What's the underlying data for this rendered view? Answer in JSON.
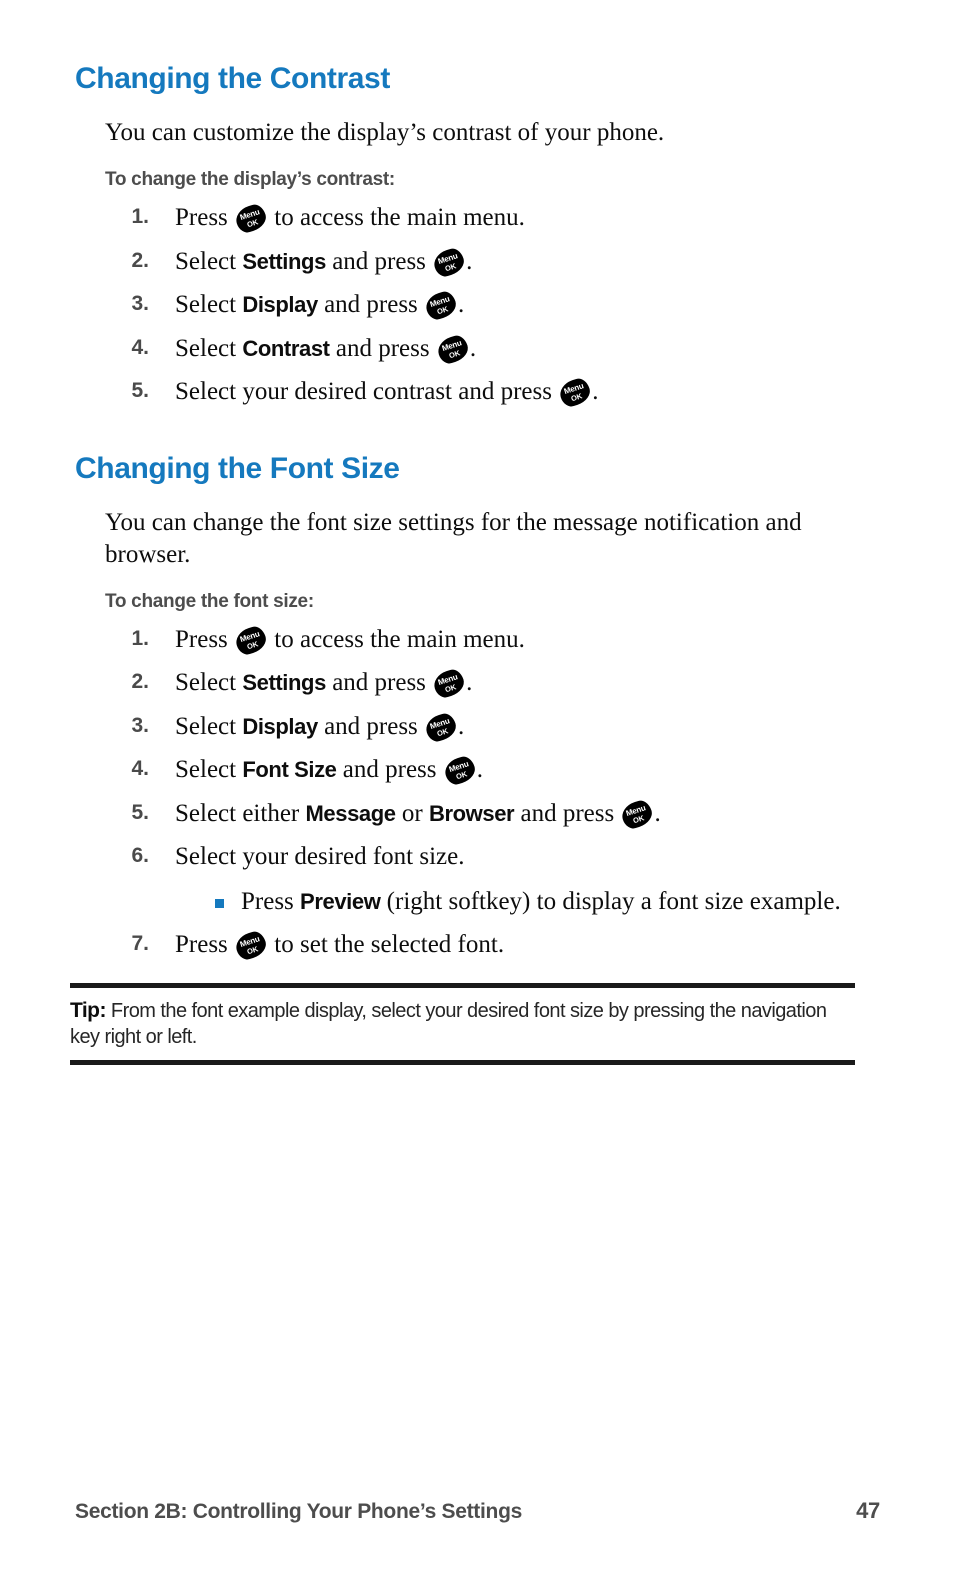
{
  "page": {
    "accent_color": "#1579be",
    "heading_color": "#1579be",
    "body_color": "#0d0d0d",
    "muted_color": "#4d4d4d",
    "rule_color": "#1a1a1a",
    "background": "#ffffff"
  },
  "sections": [
    {
      "heading": "Changing the Contrast",
      "intro": "You can customize the display’s contrast of your phone.",
      "lead_in": "To change the display’s contrast:",
      "steps": [
        {
          "number": "1.",
          "parts": [
            {
              "type": "text",
              "value": "Press "
            },
            {
              "type": "key",
              "value": "menu-ok-key"
            },
            {
              "type": "text",
              "value": " to access the main menu."
            }
          ]
        },
        {
          "number": "2.",
          "parts": [
            {
              "type": "text",
              "value": "Select "
            },
            {
              "type": "bold",
              "value": "Settings"
            },
            {
              "type": "text",
              "value": " and press "
            },
            {
              "type": "key",
              "value": "menu-ok-key"
            },
            {
              "type": "text",
              "value": "."
            }
          ]
        },
        {
          "number": "3.",
          "parts": [
            {
              "type": "text",
              "value": "Select "
            },
            {
              "type": "bold",
              "value": "Display"
            },
            {
              "type": "text",
              "value": " and press "
            },
            {
              "type": "key",
              "value": "menu-ok-key"
            },
            {
              "type": "text",
              "value": "."
            }
          ]
        },
        {
          "number": "4.",
          "parts": [
            {
              "type": "text",
              "value": "Select "
            },
            {
              "type": "bold",
              "value": "Contrast"
            },
            {
              "type": "text",
              "value": " and press "
            },
            {
              "type": "key",
              "value": "menu-ok-key"
            },
            {
              "type": "text",
              "value": "."
            }
          ]
        },
        {
          "number": "5.",
          "parts": [
            {
              "type": "text",
              "value": "Select your desired contrast and press "
            },
            {
              "type": "key",
              "value": "menu-ok-key"
            },
            {
              "type": "text",
              "value": "."
            }
          ]
        }
      ]
    },
    {
      "heading": "Changing the Font Size",
      "intro": "You can change the font size settings for the message notification and browser.",
      "lead_in": "To change the font size:",
      "steps": [
        {
          "number": "1.",
          "parts": [
            {
              "type": "text",
              "value": "Press "
            },
            {
              "type": "key",
              "value": "menu-ok-key"
            },
            {
              "type": "text",
              "value": " to access the main menu."
            }
          ]
        },
        {
          "number": "2.",
          "parts": [
            {
              "type": "text",
              "value": "Select "
            },
            {
              "type": "bold",
              "value": "Settings"
            },
            {
              "type": "text",
              "value": " and press "
            },
            {
              "type": "key",
              "value": "menu-ok-key"
            },
            {
              "type": "text",
              "value": "."
            }
          ]
        },
        {
          "number": "3.",
          "parts": [
            {
              "type": "text",
              "value": "Select "
            },
            {
              "type": "bold",
              "value": "Display"
            },
            {
              "type": "text",
              "value": " and press "
            },
            {
              "type": "key",
              "value": "menu-ok-key"
            },
            {
              "type": "text",
              "value": "."
            }
          ]
        },
        {
          "number": "4.",
          "parts": [
            {
              "type": "text",
              "value": "Select "
            },
            {
              "type": "bold",
              "value": "Font Size"
            },
            {
              "type": "text",
              "value": " and press "
            },
            {
              "type": "key",
              "value": "menu-ok-key"
            },
            {
              "type": "text",
              "value": "."
            }
          ]
        },
        {
          "number": "5.",
          "parts": [
            {
              "type": "text",
              "value": "Select either "
            },
            {
              "type": "bold",
              "value": "Message"
            },
            {
              "type": "text",
              "value": " or "
            },
            {
              "type": "bold",
              "value": "Browser"
            },
            {
              "type": "text",
              "value": " and press "
            },
            {
              "type": "key",
              "value": "menu-ok-key"
            },
            {
              "type": "text",
              "value": "."
            }
          ]
        },
        {
          "number": "6.",
          "parts": [
            {
              "type": "text",
              "value": "Select your desired font size."
            }
          ],
          "sub_bullets": [
            {
              "parts": [
                {
                  "type": "text",
                  "value": "Press "
                },
                {
                  "type": "bold",
                  "value": "Preview"
                },
                {
                  "type": "text",
                  "value": " (right softkey) to display a font size example."
                }
              ]
            }
          ]
        },
        {
          "number": "7.",
          "parts": [
            {
              "type": "text",
              "value": "Press "
            },
            {
              "type": "key",
              "value": "menu-ok-key"
            },
            {
              "type": "text",
              "value": " to set the selected font."
            }
          ]
        }
      ]
    }
  ],
  "tip": {
    "label": "Tip:",
    "text": " From the font example display, select your desired font size by pressing the navigation key right or left."
  },
  "menu_key": {
    "icon_name": "menu-ok-key-icon",
    "line1": "Menu",
    "line2": "OK"
  },
  "footer": {
    "section_label": "Section 2B: Controlling Your Phone’s Settings",
    "page_number": "47"
  }
}
